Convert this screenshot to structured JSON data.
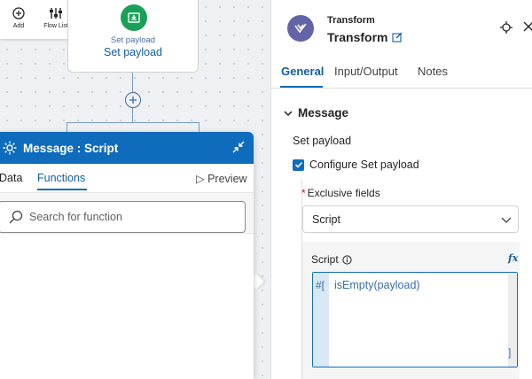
{
  "toolbar": {
    "add_label": "Add",
    "flow_list_label": "Flow List"
  },
  "flow_node": {
    "subtitle": "Set payload",
    "title": "Set payload",
    "icon": "set-payload-icon",
    "accent": "#1aa058"
  },
  "popup": {
    "title": "Message :  Script",
    "tabs": [
      {
        "label": "Data",
        "active": false
      },
      {
        "label": "Functions",
        "active": true
      }
    ],
    "preview_label": "Preview",
    "search_placeholder": "Search for function",
    "header_color": "#0f6cbd"
  },
  "panel": {
    "app_label": "Transform",
    "app_title": "Transform",
    "app_icon": "transform-icon",
    "app_color": "#6264a7",
    "tabs": [
      {
        "label": "General",
        "active": true
      },
      {
        "label": "Input/Output",
        "active": false
      },
      {
        "label": "Notes",
        "active": false
      }
    ],
    "section_title": "Message",
    "set_payload_label": "Set payload",
    "configure_checkbox": {
      "label": "Configure Set payload",
      "checked": true
    },
    "exclusive_fields": {
      "required_mark": "*",
      "label": "Exclusive fields",
      "selected": "Script"
    },
    "script": {
      "label": "Script",
      "fx_label": "fx",
      "open_marker": "#[",
      "code": "isEmpty(payload)",
      "close_marker": "]"
    }
  },
  "colors": {
    "accent": "#0f6cbd",
    "link": "#115ea3"
  }
}
